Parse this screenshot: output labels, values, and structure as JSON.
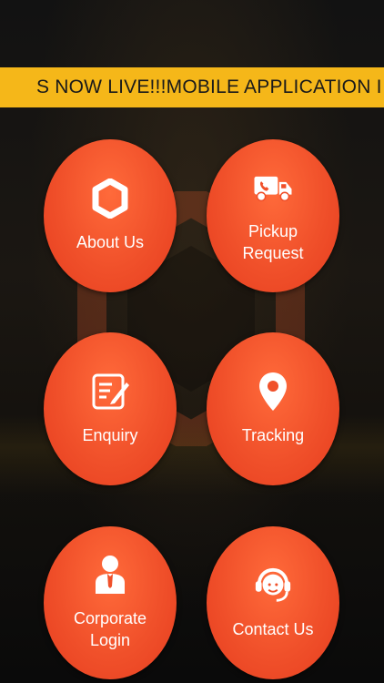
{
  "ticker": {
    "text": "S NOW LIVE!!!MOBILE APPLICATION I"
  },
  "menu": {
    "about": {
      "label": "About Us",
      "icon": "hexagon-icon"
    },
    "pickup": {
      "label": "Pickup Request",
      "icon": "delivery-truck-icon"
    },
    "enquiry": {
      "label": "Enquiry",
      "icon": "edit-form-icon"
    },
    "tracking": {
      "label": "Tracking",
      "icon": "location-pin-icon"
    },
    "corporate": {
      "label": "Corporate Login",
      "icon": "business-user-icon"
    },
    "contact": {
      "label": "Contact Us",
      "icon": "support-headset-icon"
    }
  },
  "colors": {
    "ticker_bg": "#f5b719",
    "tile_primary": "#f0502a",
    "tile_text": "#ffffff"
  }
}
